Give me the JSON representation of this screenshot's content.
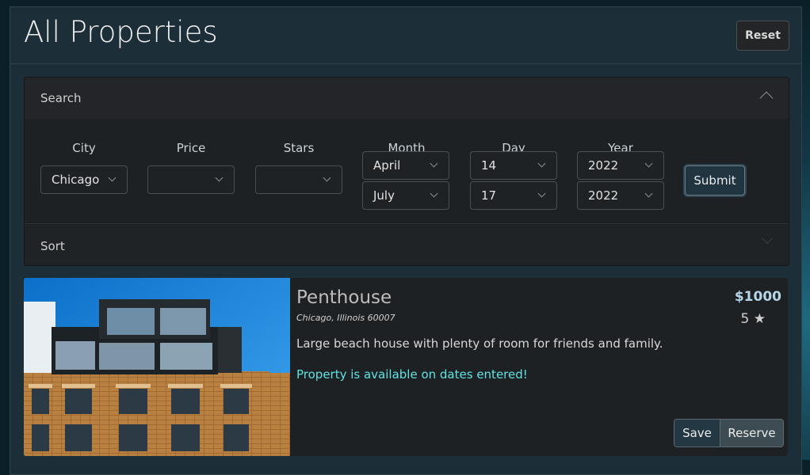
{
  "header": {
    "title": "All Properties",
    "reset_label": "Reset"
  },
  "search": {
    "label": "Search",
    "fields": {
      "city": {
        "label": "City",
        "value": "Chicago"
      },
      "price": {
        "label": "Price",
        "value": ""
      },
      "stars": {
        "label": "Stars",
        "value": ""
      },
      "month": {
        "label": "Month",
        "start": "April",
        "end": "July"
      },
      "day": {
        "label": "Day",
        "start": "14",
        "end": "17"
      },
      "year": {
        "label": "Year",
        "start": "2022",
        "end": "2022"
      }
    },
    "submit_label": "Submit"
  },
  "sort": {
    "label": "Sort"
  },
  "listing": {
    "title": "Penthouse",
    "address": "Chicago, Illinois 60007",
    "description": "Large beach house with plenty of room for friends and family.",
    "availability": "Property is available on dates entered!",
    "price": "$1000",
    "rating": "5 ★",
    "save_label": "Save",
    "reserve_label": "Reserve"
  },
  "colors": {
    "accent": "#5fe3e3",
    "panel": "#1c2f38",
    "card": "#1e2124"
  }
}
